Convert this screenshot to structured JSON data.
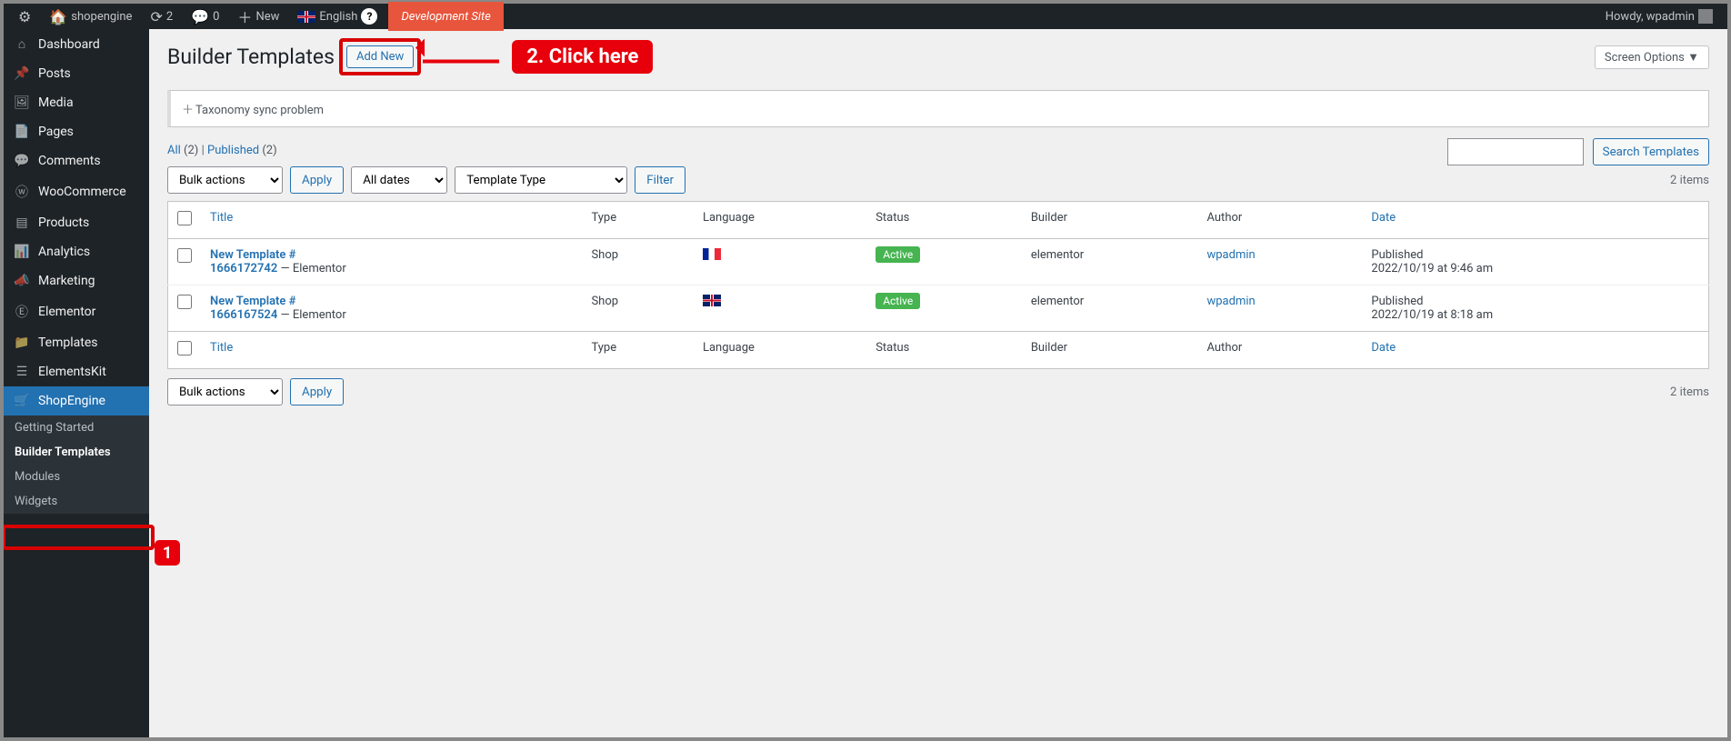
{
  "adminbar": {
    "site_name": "shopengine",
    "updates": "2",
    "comments": "0",
    "new": "New",
    "language": "English",
    "dev_site": "Development Site",
    "greeting": "Howdy, wpadmin"
  },
  "menu": {
    "dashboard": "Dashboard",
    "posts": "Posts",
    "media": "Media",
    "pages": "Pages",
    "comments": "Comments",
    "woocommerce": "WooCommerce",
    "products": "Products",
    "analytics": "Analytics",
    "marketing": "Marketing",
    "elementor": "Elementor",
    "templates": "Templates",
    "elementskit": "ElementsKit",
    "shopengine": "ShopEngine"
  },
  "submenu": {
    "getting_started": "Getting Started",
    "builder_templates": "Builder Templates",
    "modules": "Modules",
    "widgets": "Widgets"
  },
  "page": {
    "title": "Builder Templates",
    "add_new": "Add New",
    "screen_options": "Screen Options"
  },
  "notice": {
    "text": "Taxonomy sync problem"
  },
  "annotations": {
    "callout2": "2. Click here",
    "badge1": "1"
  },
  "filters": {
    "all_label": "All",
    "all_count": "(2)",
    "published_label": "Published",
    "published_count": "(2)",
    "separator": "|"
  },
  "search": {
    "button": "Search Templates"
  },
  "bulk": {
    "label": "Bulk actions",
    "apply": "Apply"
  },
  "filterbar": {
    "dates": "All dates",
    "template_type": "Template Type",
    "filter": "Filter",
    "count": "2 items"
  },
  "columns": {
    "title": "Title",
    "type": "Type",
    "language": "Language",
    "status": "Status",
    "builder": "Builder",
    "author": "Author",
    "date": "Date"
  },
  "rows": [
    {
      "title_a": "New Template #",
      "title_b": "1666172742",
      "suffix": " — Elementor",
      "type": "Shop",
      "flag": "fr",
      "status": "Active",
      "builder": "elementor",
      "author": "wpadmin",
      "date_label": "Published",
      "date_value": "2022/10/19 at 9:46 am"
    },
    {
      "title_a": "New Template #",
      "title_b": "1666167524",
      "suffix": " — Elementor",
      "type": "Shop",
      "flag": "gb",
      "status": "Active",
      "builder": "elementor",
      "author": "wpadmin",
      "date_label": "Published",
      "date_value": "2022/10/19 at 8:18 am"
    }
  ]
}
